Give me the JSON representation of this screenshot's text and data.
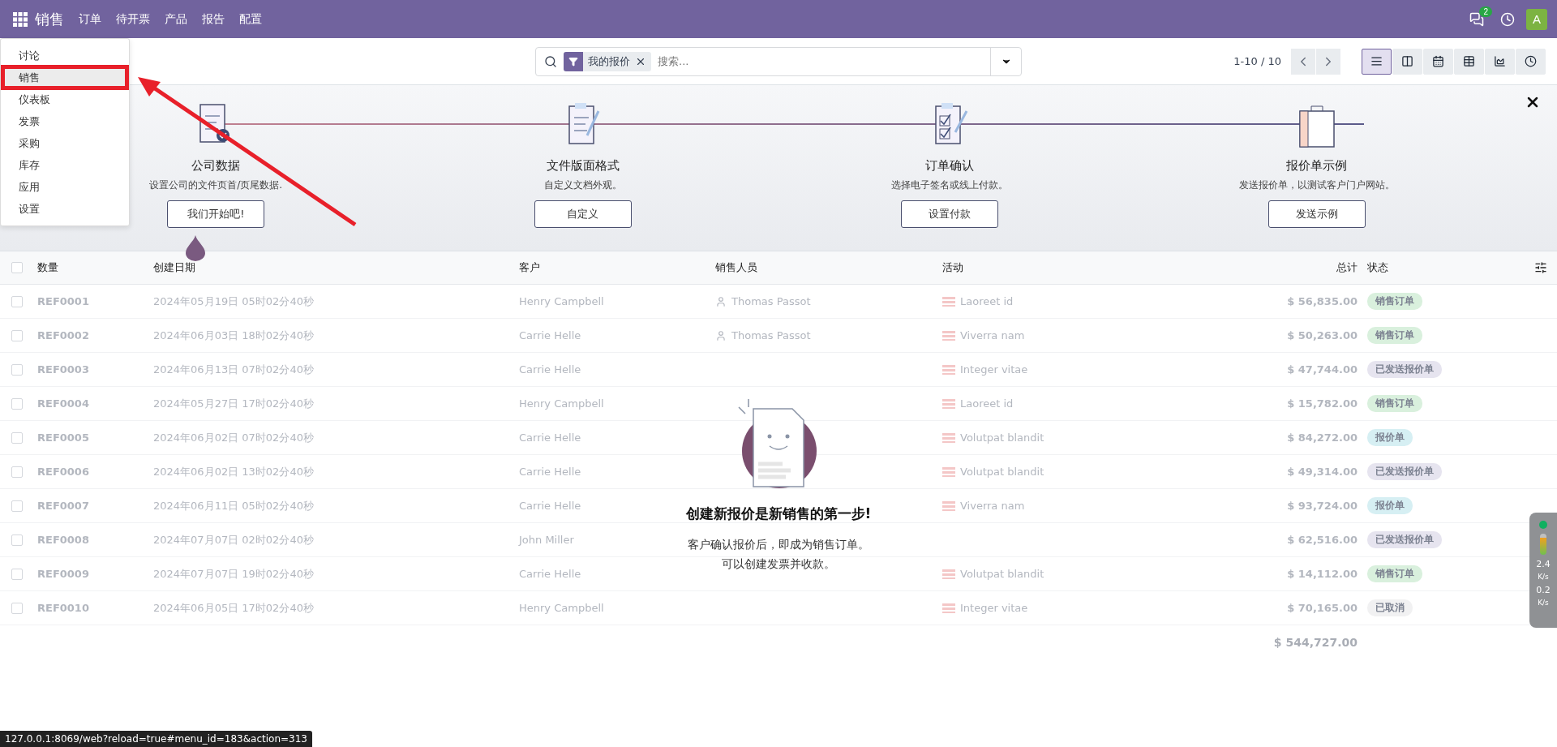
{
  "navbar": {
    "app_name": "销售",
    "menu": [
      "订单",
      "待开票",
      "产品",
      "报告",
      "配置"
    ],
    "messages_badge": "2",
    "avatar_letter": "A"
  },
  "app_menu": {
    "items": [
      {
        "label": "讨论",
        "selected": false
      },
      {
        "label": "销售",
        "selected": true
      },
      {
        "label": "仪表板",
        "selected": false
      },
      {
        "label": "发票",
        "selected": false
      },
      {
        "label": "采购",
        "selected": false
      },
      {
        "label": "库存",
        "selected": false
      },
      {
        "label": "应用",
        "selected": false
      },
      {
        "label": "设置",
        "selected": false
      }
    ]
  },
  "search": {
    "facet": "我的报价",
    "placeholder": "搜索..."
  },
  "pager": "1-10 / 10",
  "views": [
    {
      "kind": "list",
      "selected": true
    },
    {
      "kind": "kanban",
      "selected": false
    },
    {
      "kind": "calendar",
      "selected": false
    },
    {
      "kind": "pivot",
      "selected": false
    },
    {
      "kind": "graph",
      "selected": false
    },
    {
      "kind": "activity",
      "selected": false
    }
  ],
  "onboarding": {
    "steps": [
      {
        "kind": "company",
        "title": "公司数据",
        "description": "设置公司的文件页首/页尾数据.",
        "button": "我们开始吧!"
      },
      {
        "kind": "layout",
        "title": "文件版面格式",
        "description": "自定义文档外观。",
        "button": "自定义"
      },
      {
        "kind": "confirm",
        "title": "订单确认",
        "description": "选择电子签名或线上付款。",
        "button": "设置付款"
      },
      {
        "kind": "sample",
        "title": "报价单示例",
        "description": "发送报价单，以测试客户门户网站。",
        "button": "发送示例"
      }
    ]
  },
  "table": {
    "select_all_checked": false,
    "columns": [
      "数量",
      "创建日期",
      "客户",
      "销售人员",
      "活动",
      "总计",
      "状态"
    ],
    "rows": [
      {
        "ref": "REF0001",
        "date": "2024年05月19日 05时02分40秒",
        "customer": "Henry Campbell",
        "salesperson": "Thomas Passot",
        "activity": "Laoreet id",
        "total": "$ 56,835.00",
        "status": {
          "label": "销售订单",
          "color": "#d9f0dd"
        }
      },
      {
        "ref": "REF0002",
        "date": "2024年06月03日 18时02分40秒",
        "customer": "Carrie Helle",
        "salesperson": "Thomas Passot",
        "activity": "Viverra nam",
        "total": "$ 50,263.00",
        "status": {
          "label": "销售订单",
          "color": "#d9f0dd"
        }
      },
      {
        "ref": "REF0003",
        "date": "2024年06月13日 07时02分40秒",
        "customer": "Carrie Helle",
        "activity": "Integer vitae",
        "total": "$ 47,744.00",
        "status": {
          "label": "已发送报价单",
          "color": "#e6e4ef"
        }
      },
      {
        "ref": "REF0004",
        "date": "2024年05月27日 17时02分40秒",
        "customer": "Henry Campbell",
        "activity": "Laoreet id",
        "total": "$ 15,782.00",
        "status": {
          "label": "销售订单",
          "color": "#d9f0dd"
        }
      },
      {
        "ref": "REF0005",
        "date": "2024年06月02日 07时02分40秒",
        "customer": "Carrie Helle",
        "activity": "Volutpat blandit",
        "total": "$ 84,272.00",
        "status": {
          "label": "报价单",
          "color": "#d6eff3"
        }
      },
      {
        "ref": "REF0006",
        "date": "2024年06月02日 13时02分40秒",
        "customer": "Carrie Helle",
        "activity": "Volutpat blandit",
        "total": "$ 49,314.00",
        "status": {
          "label": "已发送报价单",
          "color": "#e6e4ef"
        }
      },
      {
        "ref": "REF0007",
        "date": "2024年06月11日 05时02分40秒",
        "customer": "Carrie Helle",
        "activity": "Viverra nam",
        "total": "$ 93,724.00",
        "status": {
          "label": "报价单",
          "color": "#d6eff3"
        }
      },
      {
        "ref": "REF0008",
        "date": "2024年07月07日 02时02分40秒",
        "customer": "John Miller",
        "total": "$ 62,516.00",
        "status": {
          "label": "已发送报价单",
          "color": "#e6e4ef"
        }
      },
      {
        "ref": "REF0009",
        "date": "2024年07月07日 19时02分40秒",
        "customer": "Carrie Helle",
        "activity": "Volutpat blandit",
        "total": "$ 14,112.00",
        "status": {
          "label": "销售订单",
          "color": "#d9f0dd"
        }
      },
      {
        "ref": "REF0010",
        "date": "2024年06月05日 17时02分40秒",
        "customer": "Henry Campbell",
        "activity": "Integer vitae",
        "total": "$ 70,165.00",
        "status": {
          "label": "已取消",
          "color": "#f1f1f2"
        }
      }
    ],
    "grand_total": "$ 544,727.00"
  },
  "empty_state": {
    "title": "创建新报价是新销售的第一步!",
    "lines": [
      "客户确认报价后，即成为销售订单。",
      "可以创建发票并收款。"
    ]
  },
  "status_url": "127.0.0.1:8069/web?reload=true#menu_id=183&action=313",
  "net_widget": {
    "up": "2.4",
    "up_unit": "K/s",
    "down": "0.2",
    "down_unit": "K/s"
  }
}
